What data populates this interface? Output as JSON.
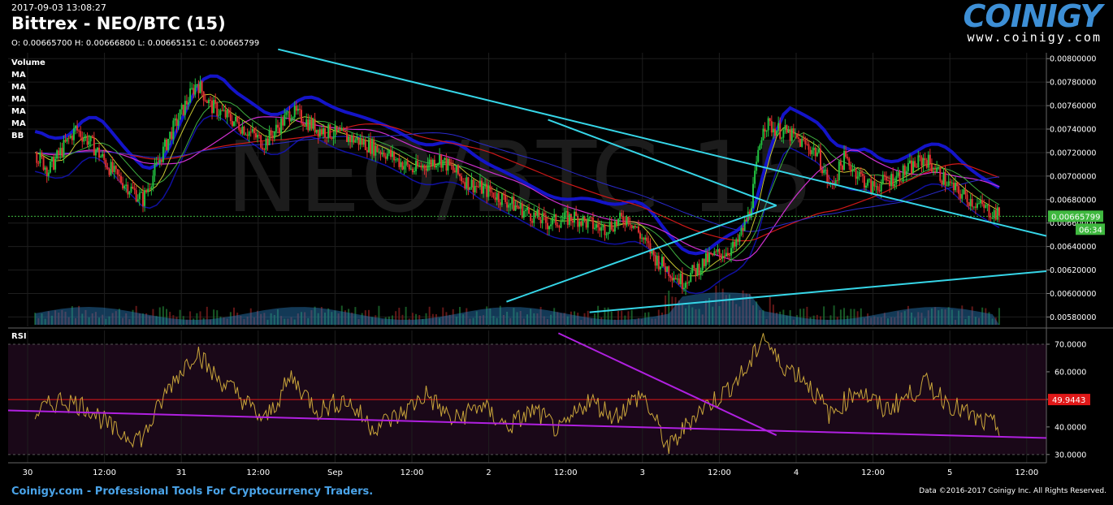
{
  "header": {
    "timestamp": "2017-09-03 13:08:27",
    "title": "Bittrex - NEO/BTC (15)",
    "ohlc": "O: 0.00665700 H: 0.00666800 L: 0.00665151 C: 0.00665799"
  },
  "logo": {
    "word": "COINIGY",
    "url": "www.coinigy.com"
  },
  "legend": [
    "Volume",
    "MA",
    "MA",
    "MA",
    "MA",
    "MA",
    "BB"
  ],
  "footer": {
    "left": "Coinigy.com - Professional Tools For Cryptocurrency Traders.",
    "right": "Data ©2016-2017 Coinigy Inc. All Rights Reserved."
  },
  "watermark": "NEO/BTC 15",
  "colors": {
    "up": "#22c040",
    "down": "#e03030",
    "trendline": "#36d6e8",
    "rsi_trendline": "#b020e0",
    "rsi_line": "#c9a53a",
    "ma_red": "#d01818",
    "ma_purple": "#d030d0",
    "ma_blue": "#2a2acc",
    "bb_band": "#1414c8",
    "last_price": "#3fb83f",
    "rsi_level": "#e01818"
  },
  "chart_data": [
    {
      "type": "candlestick",
      "title": "Bittrex - NEO/BTC (15)",
      "x_ticks": [
        "30",
        "12:00",
        "31",
        "12:00",
        "Sep",
        "12:00",
        "2",
        "12:00",
        "3",
        "12:00",
        "4",
        "12:00",
        "5",
        "12:00"
      ],
      "y_ticks": [
        "0.00800000",
        "0.00780000",
        "0.00760000",
        "0.00740000",
        "0.00720000",
        "0.00700000",
        "0.00680000",
        "0.00660000",
        "0.00640000",
        "0.00620000",
        "0.00600000",
        "0.00580000"
      ],
      "ylim": [
        0.00572,
        0.00805
      ],
      "xlim_hours": [
        -4,
        150
      ],
      "last_price": 0.00665799,
      "last_price_label": "0.00665799",
      "countdown_label": "06:34",
      "price_path": [
        {
          "t": 0,
          "p": 0.0072
        },
        {
          "t": 2,
          "p": 0.00705
        },
        {
          "t": 6,
          "p": 0.0074
        },
        {
          "t": 8,
          "p": 0.0073
        },
        {
          "t": 12,
          "p": 0.007
        },
        {
          "t": 16,
          "p": 0.0068
        },
        {
          "t": 20,
          "p": 0.00735
        },
        {
          "t": 24,
          "p": 0.0078
        },
        {
          "t": 26,
          "p": 0.0076
        },
        {
          "t": 30,
          "p": 0.00745
        },
        {
          "t": 34,
          "p": 0.00728
        },
        {
          "t": 38,
          "p": 0.00755
        },
        {
          "t": 42,
          "p": 0.0074
        },
        {
          "t": 48,
          "p": 0.0073
        },
        {
          "t": 52,
          "p": 0.0072
        },
        {
          "t": 56,
          "p": 0.00705
        },
        {
          "t": 60,
          "p": 0.00715
        },
        {
          "t": 64,
          "p": 0.00695
        },
        {
          "t": 68,
          "p": 0.00685
        },
        {
          "t": 72,
          "p": 0.00672
        },
        {
          "t": 76,
          "p": 0.0066
        },
        {
          "t": 80,
          "p": 0.00665
        },
        {
          "t": 84,
          "p": 0.00655
        },
        {
          "t": 88,
          "p": 0.00665
        },
        {
          "t": 92,
          "p": 0.0063
        },
        {
          "t": 96,
          "p": 0.0061
        },
        {
          "t": 100,
          "p": 0.0063
        },
        {
          "t": 104,
          "p": 0.0064
        },
        {
          "t": 106,
          "p": 0.0067
        },
        {
          "t": 108,
          "p": 0.00745
        },
        {
          "t": 112,
          "p": 0.00735
        },
        {
          "t": 116,
          "p": 0.0072
        },
        {
          "t": 118,
          "p": 0.0069
        },
        {
          "t": 120,
          "p": 0.00715
        },
        {
          "t": 124,
          "p": 0.0069
        },
        {
          "t": 128,
          "p": 0.007
        },
        {
          "t": 132,
          "p": 0.00715
        },
        {
          "t": 136,
          "p": 0.0069
        },
        {
          "t": 140,
          "p": 0.00675
        },
        {
          "t": 143,
          "p": 0.00666
        }
      ],
      "trendlines": [
        {
          "from": [
            0.26,
            0.00808
          ],
          "to": [
            1.0,
            0.00649
          ]
        },
        {
          "from": [
            0.52,
            0.00748
          ],
          "to": [
            0.74,
            0.00675
          ]
        },
        {
          "from": [
            0.48,
            0.00593
          ],
          "to": [
            0.74,
            0.00675
          ]
        },
        {
          "from": [
            0.56,
            0.00584
          ],
          "to": [
            1.0,
            0.00619
          ]
        }
      ]
    },
    {
      "type": "line",
      "title": "RSI",
      "ylabel": "",
      "y_ticks": [
        "70.0000",
        "60.0000",
        "50.0000",
        "40.0000",
        "30.0000"
      ],
      "ylim": [
        27,
        75
      ],
      "rsi_level": 49.9443,
      "rsi_level_label": "49.9443",
      "rsi_path": [
        {
          "t": 0,
          "v": 45
        },
        {
          "t": 4,
          "v": 50
        },
        {
          "t": 8,
          "v": 47
        },
        {
          "t": 12,
          "v": 38
        },
        {
          "t": 16,
          "v": 36
        },
        {
          "t": 20,
          "v": 55
        },
        {
          "t": 24,
          "v": 68
        },
        {
          "t": 26,
          "v": 60
        },
        {
          "t": 30,
          "v": 52
        },
        {
          "t": 34,
          "v": 42
        },
        {
          "t": 38,
          "v": 58
        },
        {
          "t": 42,
          "v": 46
        },
        {
          "t": 46,
          "v": 50
        },
        {
          "t": 50,
          "v": 40
        },
        {
          "t": 54,
          "v": 44
        },
        {
          "t": 58,
          "v": 52
        },
        {
          "t": 62,
          "v": 42
        },
        {
          "t": 66,
          "v": 48
        },
        {
          "t": 70,
          "v": 40
        },
        {
          "t": 74,
          "v": 46
        },
        {
          "t": 78,
          "v": 38
        },
        {
          "t": 82,
          "v": 50
        },
        {
          "t": 86,
          "v": 44
        },
        {
          "t": 90,
          "v": 52
        },
        {
          "t": 94,
          "v": 32
        },
        {
          "t": 98,
          "v": 45
        },
        {
          "t": 102,
          "v": 52
        },
        {
          "t": 106,
          "v": 62
        },
        {
          "t": 108,
          "v": 74
        },
        {
          "t": 110,
          "v": 64
        },
        {
          "t": 114,
          "v": 58
        },
        {
          "t": 118,
          "v": 44
        },
        {
          "t": 122,
          "v": 54
        },
        {
          "t": 126,
          "v": 46
        },
        {
          "t": 130,
          "v": 52
        },
        {
          "t": 132,
          "v": 56
        },
        {
          "t": 136,
          "v": 48
        },
        {
          "t": 140,
          "v": 42
        },
        {
          "t": 143,
          "v": 40
        }
      ],
      "trendlines": [
        {
          "from": [
            0.0,
            46
          ],
          "to": [
            1.0,
            36
          ]
        },
        {
          "from": [
            0.53,
            74
          ],
          "to": [
            0.74,
            37
          ]
        }
      ]
    }
  ]
}
